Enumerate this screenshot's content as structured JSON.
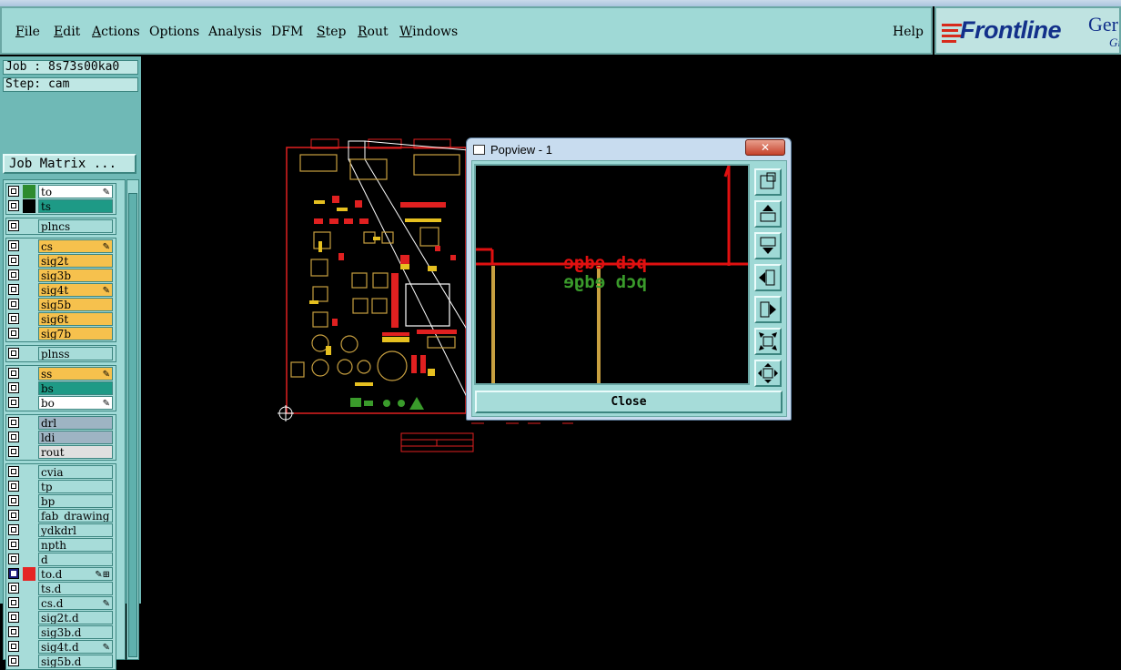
{
  "menu": {
    "items": [
      {
        "label": "File"
      },
      {
        "label": "Edit"
      },
      {
        "label": "Actions"
      },
      {
        "label": "Options"
      },
      {
        "label": "Analysis"
      },
      {
        "label": "DFM"
      },
      {
        "label": "Step"
      },
      {
        "label": "Rout"
      },
      {
        "label": "Windows"
      }
    ],
    "help": "Help"
  },
  "brand": {
    "name": "Frontline",
    "ge": "Ger",
    "gi": "Gi"
  },
  "job": {
    "job_label": "Job : 8s73s00ka0",
    "step_label": "Step: cam",
    "matrix_button": "Job Matrix ..."
  },
  "layers": [
    {
      "name": "to",
      "color": "#2e8b2e",
      "bg": "#ffffff",
      "affect": "✎"
    },
    {
      "name": "ts",
      "color": "#000000",
      "bg": "#1e9a86",
      "affect": ""
    },
    {
      "name": "plncs",
      "color": "",
      "bg": "#a7dcd9",
      "affect": ""
    },
    {
      "name": "cs",
      "color": "",
      "bg": "#f6c14d",
      "affect": "✎"
    },
    {
      "name": "sig2t",
      "color": "",
      "bg": "#f6c14d",
      "affect": ""
    },
    {
      "name": "sig3b",
      "color": "",
      "bg": "#f6c14d",
      "affect": ""
    },
    {
      "name": "sig4t",
      "color": "",
      "bg": "#f6c14d",
      "affect": "✎"
    },
    {
      "name": "sig5b",
      "color": "",
      "bg": "#f6c14d",
      "affect": ""
    },
    {
      "name": "sig6t",
      "color": "",
      "bg": "#f6c14d",
      "affect": ""
    },
    {
      "name": "sig7b",
      "color": "",
      "bg": "#f6c14d",
      "affect": ""
    },
    {
      "name": "plnss",
      "color": "",
      "bg": "#a7dcd9",
      "affect": ""
    },
    {
      "name": "ss",
      "color": "",
      "bg": "#f6c14d",
      "affect": "✎"
    },
    {
      "name": "bs",
      "color": "",
      "bg": "#1e9a86",
      "affect": ""
    },
    {
      "name": "bo",
      "color": "",
      "bg": "#ffffff",
      "affect": "✎"
    },
    {
      "name": "drl",
      "color": "",
      "bg": "#9eb4c3",
      "affect": ""
    },
    {
      "name": "ldi",
      "color": "",
      "bg": "#9eb4c3",
      "affect": ""
    },
    {
      "name": "rout",
      "color": "",
      "bg": "#e0e0e0",
      "affect": ""
    },
    {
      "name": "cvia",
      "color": "",
      "bg": "#a7dcd9",
      "affect": ""
    },
    {
      "name": "tp",
      "color": "",
      "bg": "#a7dcd9",
      "affect": ""
    },
    {
      "name": "bp",
      "color": "",
      "bg": "#a7dcd9",
      "affect": ""
    },
    {
      "name": "fab_drawing",
      "color": "",
      "bg": "#a7dcd9",
      "affect": ""
    },
    {
      "name": "ydkdrl",
      "color": "",
      "bg": "#a7dcd9",
      "affect": ""
    },
    {
      "name": "npth",
      "color": "",
      "bg": "#a7dcd9",
      "affect": ""
    },
    {
      "name": "d",
      "color": "",
      "bg": "#a7dcd9",
      "affect": ""
    },
    {
      "name": "to.d",
      "color": "#e52525",
      "bg": "#a7dcd9",
      "affect": "✎⊞",
      "active": true
    },
    {
      "name": "ts.d",
      "color": "",
      "bg": "#a7dcd9",
      "affect": ""
    },
    {
      "name": "cs.d",
      "color": "",
      "bg": "#a7dcd9",
      "affect": "✎"
    },
    {
      "name": "sig2t.d",
      "color": "",
      "bg": "#a7dcd9",
      "affect": ""
    },
    {
      "name": "sig3b.d",
      "color": "",
      "bg": "#a7dcd9",
      "affect": ""
    },
    {
      "name": "sig4t.d",
      "color": "",
      "bg": "#a7dcd9",
      "affect": "✎"
    },
    {
      "name": "sig5b.d",
      "color": "",
      "bg": "#a7dcd9",
      "affect": ""
    }
  ],
  "popview": {
    "title": "Popview - 1",
    "close_x": "✕",
    "close_button": "Close",
    "labels": [
      "pcb edge",
      "pcb edge"
    ]
  },
  "colors": {
    "accent": "#9fd9d6",
    "red": "#ff0000",
    "green": "#3a9b2b",
    "gold": "#c8a040"
  }
}
